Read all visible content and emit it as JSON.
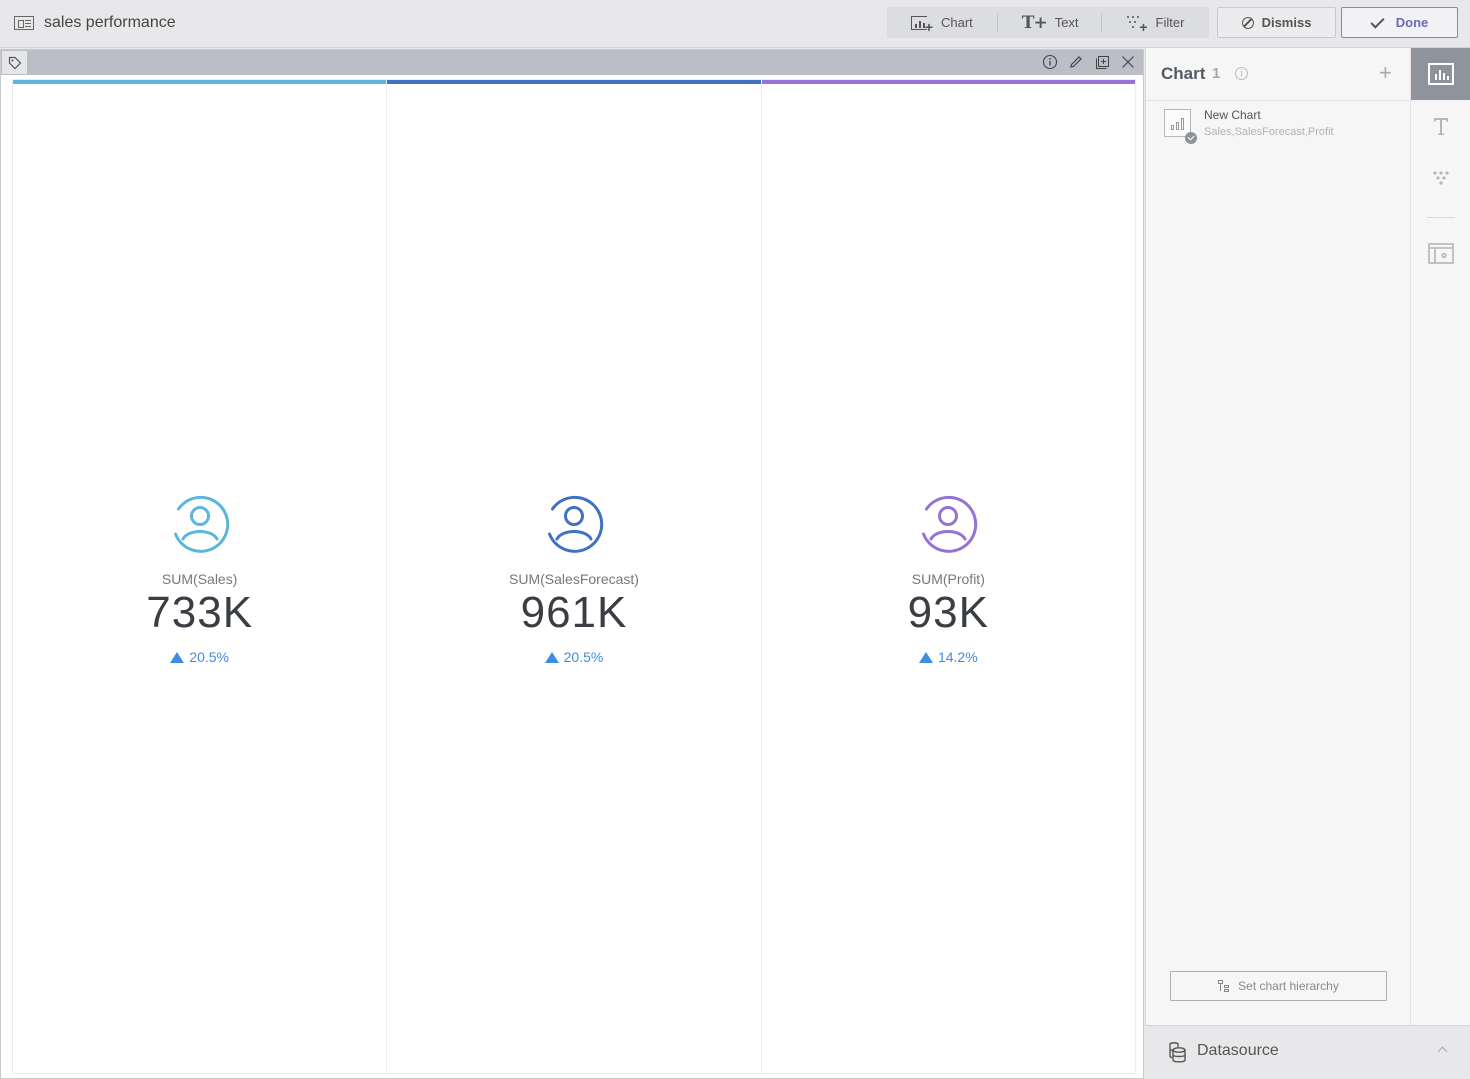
{
  "header": {
    "title": "sales performance",
    "title_icon": "dashboard-icon",
    "toolbar": {
      "chart_label": "Chart",
      "text_label": "Text",
      "filter_label": "Filter"
    },
    "dismiss_label": "Dismiss",
    "done_label": "Done"
  },
  "widget": {
    "head_icons": [
      "tag-icon",
      "info-icon",
      "edit-icon",
      "duplicate-icon",
      "close-icon"
    ],
    "kpis": [
      {
        "label": "SUM(Sales)",
        "value": "733K",
        "change": "20.5%",
        "direction": "up",
        "color": "#5bb6d9"
      },
      {
        "label": "SUM(SalesForecast)",
        "value": "961K",
        "change": "20.5%",
        "direction": "up",
        "color": "#3f72c3"
      },
      {
        "label": "SUM(Profit)",
        "value": "93K",
        "change": "14.2%",
        "direction": "up",
        "color": "#9472d6"
      }
    ],
    "change_color": "#3f8de0"
  },
  "panel": {
    "title": "Chart",
    "count": "1",
    "charts": [
      {
        "name": "New Chart",
        "fields": "Sales,SalesForecast,Profit"
      }
    ],
    "hierarchy_label": "Set chart hierarchy",
    "datasource_label": "Datasource"
  },
  "side_tabs": [
    "chart-tab",
    "text-tab",
    "filter-tab",
    "layout-settings-tab"
  ]
}
